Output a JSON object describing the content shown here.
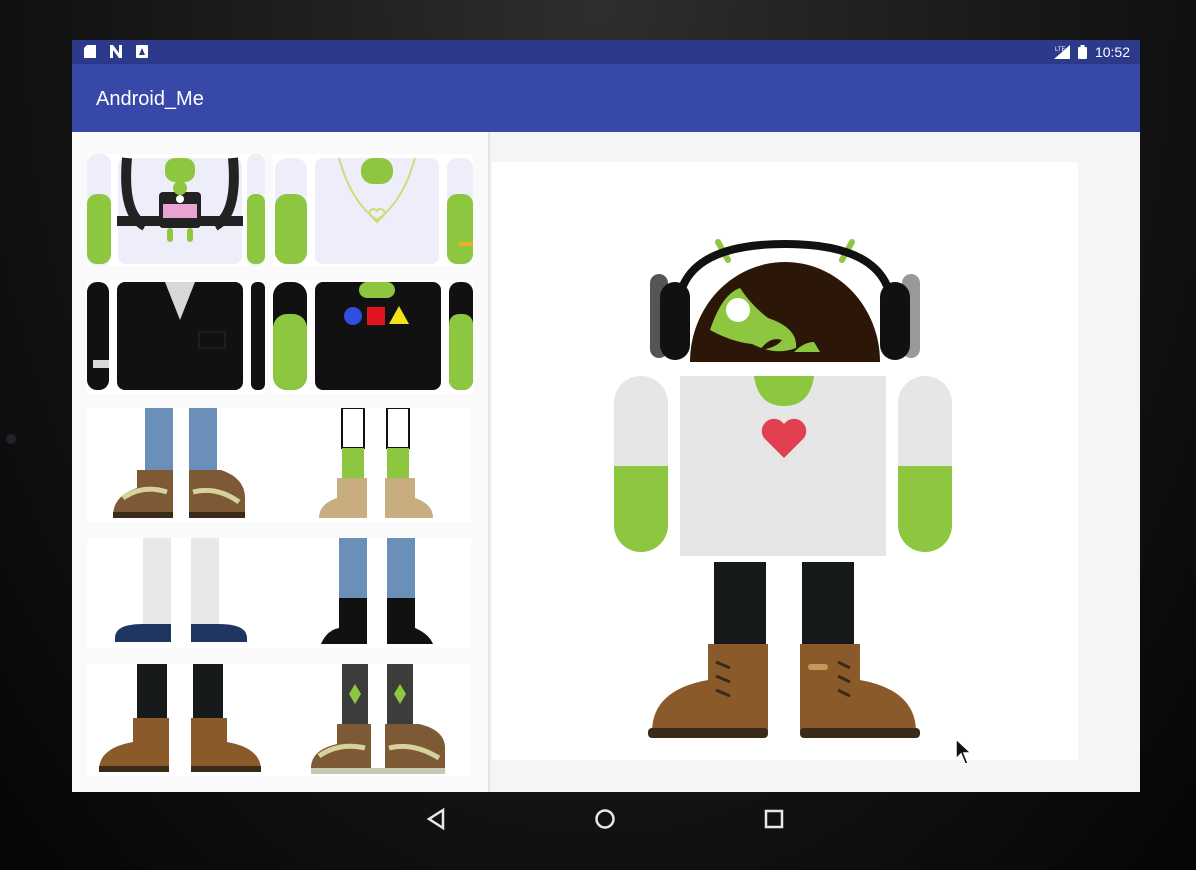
{
  "status_bar": {
    "time": "10:52",
    "left_icons": [
      "sd-card-icon",
      "nfc-icon",
      "android-notification-icon"
    ],
    "right_icons": [
      "signal-icon",
      "battery-icon"
    ]
  },
  "app_bar": {
    "title": "Android_Me"
  },
  "gallery": {
    "body_parts": [
      {
        "label": "headphones-robot-shirt",
        "kind": "body"
      },
      {
        "label": "necklace-shirt",
        "kind": "body"
      },
      {
        "label": "suit-jacket",
        "kind": "body"
      },
      {
        "label": "shapes-shirt",
        "kind": "body"
      }
    ],
    "leg_parts": [
      {
        "label": "jeans-hiking-boots",
        "kind": "legs"
      },
      {
        "label": "green-legs-fur-boots",
        "kind": "legs"
      },
      {
        "label": "white-pants-loafers",
        "kind": "legs"
      },
      {
        "label": "jeans-black-heels",
        "kind": "legs"
      },
      {
        "label": "black-pants-brown-boots",
        "kind": "legs"
      },
      {
        "label": "black-pants-sneakers",
        "kind": "legs"
      }
    ]
  },
  "preview": {
    "head": "headphones-hair",
    "body": "heart-shirt",
    "legs": "black-pants-brown-boots"
  },
  "colors": {
    "status_bar": "#2d3a8c",
    "app_bar": "#3848a8",
    "android_green": "#8dc63f",
    "hair": "#2b1608",
    "boot_brown": "#8b5a2b",
    "heart_red": "#e0404f"
  },
  "nav": {
    "buttons": [
      "back-icon",
      "home-icon",
      "recents-icon"
    ]
  }
}
